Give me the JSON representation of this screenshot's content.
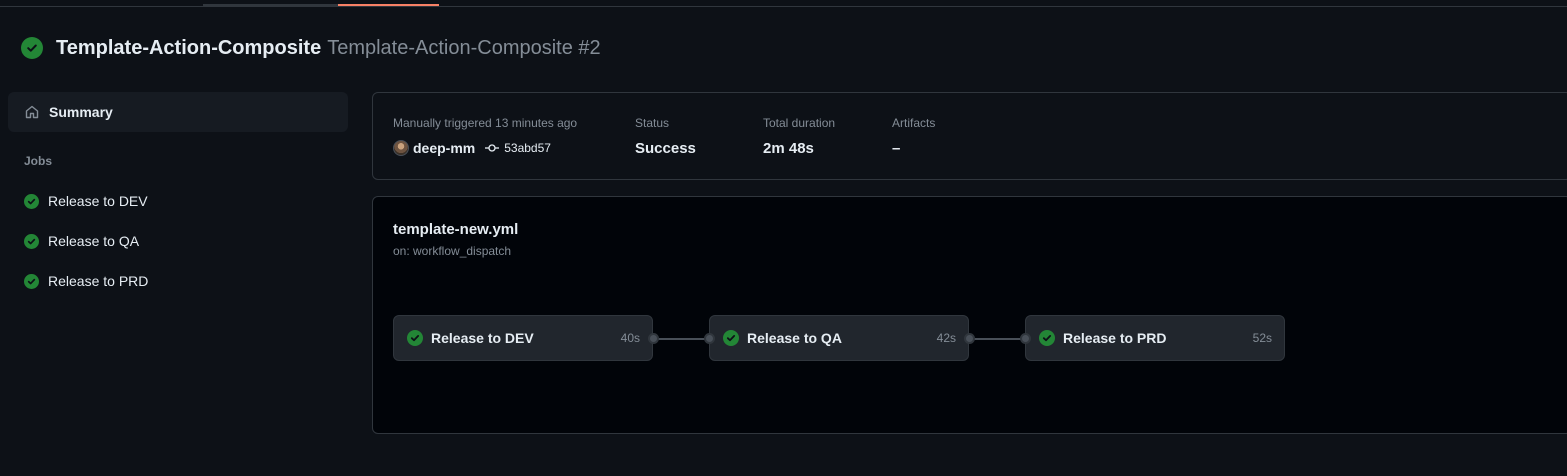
{
  "header": {
    "workflow_title": "Template-Action-Composite",
    "run_title": "Template-Action-Composite #2"
  },
  "sidebar": {
    "summary_label": "Summary",
    "jobs_heading": "Jobs",
    "jobs": [
      {
        "label": "Release to DEV",
        "status": "success"
      },
      {
        "label": "Release to QA",
        "status": "success"
      },
      {
        "label": "Release to PRD",
        "status": "success"
      }
    ]
  },
  "run_info": {
    "trigger_label": "Manually triggered 13 minutes ago",
    "actor": "deep-mm",
    "commit_sha": "53abd57",
    "status_label": "Status",
    "status_value": "Success",
    "duration_label": "Total duration",
    "duration_value": "2m 48s",
    "artifacts_label": "Artifacts",
    "artifacts_value": "–"
  },
  "workflow_graph": {
    "file_name": "template-new.yml",
    "trigger": "on: workflow_dispatch",
    "nodes": [
      {
        "label": "Release to DEV",
        "duration": "40s",
        "status": "success"
      },
      {
        "label": "Release to QA",
        "duration": "42s",
        "status": "success"
      },
      {
        "label": "Release to PRD",
        "duration": "52s",
        "status": "success"
      }
    ]
  },
  "colors": {
    "background": "#0d1117",
    "success": "#238636",
    "accent_tab": "#f78166",
    "muted_text": "#848d97"
  },
  "icons": {
    "status": "check-circle-icon",
    "summary": "home-icon",
    "commit": "git-commit-icon"
  }
}
